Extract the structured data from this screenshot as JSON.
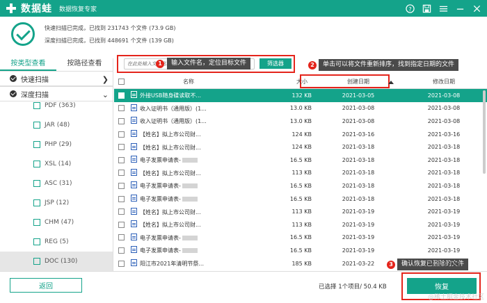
{
  "titlebar": {
    "app_name": "数据蛙",
    "subtitle": "数据恢复专家",
    "icons": [
      "help-icon",
      "save-icon",
      "menu-icon",
      "minimize-icon",
      "close-icon"
    ]
  },
  "summary": {
    "quick_scan": "快速扫描已完成，已找到 231743 个文件 (73.9 GB)",
    "deep_scan": "深度扫描已完成，已找到 448691 个文件 (139 GB)"
  },
  "left": {
    "tabs": [
      "按类型查看",
      "按路径查看"
    ],
    "quick_scan": "快速扫描",
    "deep_scan": "深度扫描",
    "types": [
      "PDF (363)",
      "JAR (48)",
      "PHP (29)",
      "XSL (14)",
      "ASC (31)",
      "JSP (12)",
      "CHM (47)",
      "REG (5)",
      "DOC (130)"
    ]
  },
  "search": {
    "placeholder": "在此处输入文件名...",
    "filter_label": "筛选器"
  },
  "annotations": {
    "a1": {
      "num": "1",
      "text": "输入文件名，定位目标文件"
    },
    "a2": {
      "num": "2",
      "text": "单击可以将文件重新排序，找到指定日期的文件"
    },
    "a3": {
      "num": "3",
      "text": "确认恢复已删除的文件"
    }
  },
  "table": {
    "headers": {
      "name": "名称",
      "size": "大小",
      "created": "创建日期",
      "modified": "修改日期"
    },
    "rows": [
      {
        "name": "外接USB随身碟读取不...",
        "size": "132 KB",
        "created": "2021-03-05",
        "modified": "2021-03-08",
        "selected": true
      },
      {
        "name": "收入证明书（通用版）(1...",
        "size": "13.0 KB",
        "created": "2021-03-08",
        "modified": "2021-03-08"
      },
      {
        "name": "收入证明书（通用版）(1...",
        "size": "13.0 KB",
        "created": "2021-03-08",
        "modified": "2021-03-08"
      },
      {
        "name": "【姓名】拟上市公司财...",
        "size": "124 KB",
        "created": "2021-03-16",
        "modified": "2021-03-16"
      },
      {
        "name": "【姓名】拟上市公司财...",
        "size": "124 KB",
        "created": "2021-03-18",
        "modified": "2021-03-18"
      },
      {
        "name": "电子发票申请表-",
        "size": "16.5 KB",
        "created": "2021-03-18",
        "modified": "2021-03-18",
        "blur": true
      },
      {
        "name": "【姓名】拟上市公司财...",
        "size": "113 KB",
        "created": "2021-03-18",
        "modified": "2021-03-18"
      },
      {
        "name": "电子发票申请表-",
        "size": "16.5 KB",
        "created": "2021-03-18",
        "modified": "2021-03-18",
        "blur": true
      },
      {
        "name": "电子发票申请表-",
        "size": "16.5 KB",
        "created": "2021-03-18",
        "modified": "2021-03-18",
        "blur": true
      },
      {
        "name": "【姓名】拟上市公司财...",
        "size": "113 KB",
        "created": "2021-03-19",
        "modified": "2021-03-19"
      },
      {
        "name": "【姓名】拟上市公司财...",
        "size": "113 KB",
        "created": "2021-03-19",
        "modified": "2021-03-19"
      },
      {
        "name": "电子发票申请表-",
        "size": "16.5 KB",
        "created": "2021-03-19",
        "modified": "2021-03-19",
        "blur": true
      },
      {
        "name": "电子发票申请表-",
        "size": "16.5 KB",
        "created": "2021-03-19",
        "modified": "2021-03-19",
        "blur": true
      },
      {
        "name": "阳江市2021年清明节祭...",
        "size": "185 KB",
        "created": "2021-03-22",
        "modified": "2021-03-22"
      }
    ]
  },
  "bottom": {
    "back_label": "返回",
    "selected_info": "已选择 1个项目/ 50.4 KB",
    "recover_label": "恢复",
    "watermark": "@稀土掘金技术社区"
  },
  "colors": {
    "accent": "#14a38a",
    "annotation": "#e4241b",
    "tooltip": "#4a4a4a"
  }
}
